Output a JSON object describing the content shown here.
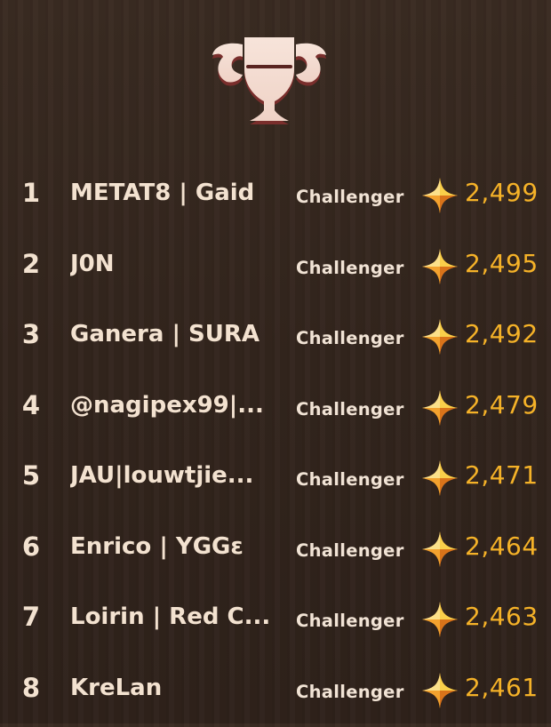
{
  "leaderboard": {
    "trophy_icon": "trophy-icon",
    "currency_icon": "four-point-star-icon",
    "colors": {
      "text": "#f3e2d0",
      "score": "#f5b228",
      "background": "#35271f"
    },
    "rows": [
      {
        "rank": "1",
        "name": "METAT8 | Gaid",
        "tier": "Challenger",
        "score": "2,499"
      },
      {
        "rank": "2",
        "name": "J0N",
        "tier": "Challenger",
        "score": "2,495"
      },
      {
        "rank": "3",
        "name": "Ganera | SURA",
        "tier": "Challenger",
        "score": "2,492"
      },
      {
        "rank": "4",
        "name": "@nagipex99|...",
        "tier": "Challenger",
        "score": "2,479"
      },
      {
        "rank": "5",
        "name": "JAU|louwtjie...",
        "tier": "Challenger",
        "score": "2,471"
      },
      {
        "rank": "6",
        "name": "Enrico | YGGε",
        "tier": "Challenger",
        "score": "2,464"
      },
      {
        "rank": "7",
        "name": "Loirin | Red C...",
        "tier": "Challenger",
        "score": "2,463"
      },
      {
        "rank": "8",
        "name": "KreLan",
        "tier": "Challenger",
        "score": "2,461"
      }
    ]
  }
}
